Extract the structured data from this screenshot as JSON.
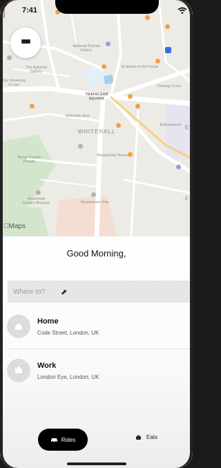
{
  "status_bar": {
    "time": "7:41",
    "icons": "wifi-icon"
  },
  "map": {
    "badge": "Maps",
    "labels": {
      "trafalgar": "TRAFALGAR SQUARE",
      "whitehall": "WHITEHALL",
      "portrait": "National Portrait Gallery",
      "st_martin": "St Martin-in-the-Fields",
      "charing": "Charing Cross",
      "embank": "Embankment",
      "horse": "Horse Guards Parade",
      "banquet": "Banqueting House",
      "admiralty": "Admiralty Arch",
      "nat_gallery": "The National Gallery",
      "uni": "The University of Law",
      "museum": "Household Cavalry Museum",
      "westminster": "Westminster Pier",
      "edge_e": "E",
      "edge_f": "F"
    }
  },
  "sheet": {
    "greeting": "Good Morning,",
    "search_placeholder": "Where to?",
    "places": [
      {
        "title": "Home",
        "subtitle": "Code Street, London, UK",
        "icon": "house-icon"
      },
      {
        "title": "Work",
        "subtitle": "London Eye, London, UK",
        "icon": "briefcase-icon"
      }
    ],
    "tabs": {
      "rides": "Rides",
      "eats": "Eats"
    }
  },
  "colors": {
    "accent": "#000000",
    "pin": "#e0342c",
    "park": "#cfe3c7",
    "water": "#a8cfe8"
  }
}
